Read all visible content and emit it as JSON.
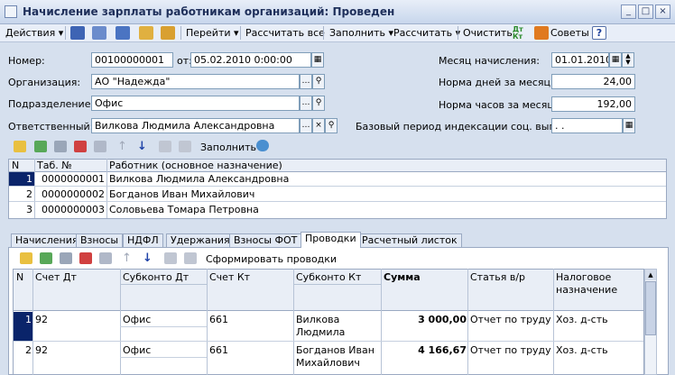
{
  "window": {
    "title": "Начисление зарплаты работникам организаций: Проведен",
    "controls": [
      "_",
      "□",
      "×"
    ]
  },
  "toolbar": {
    "actions": "Действия",
    "goto": "Перейти",
    "recalc_all": "Рассчитать все",
    "fill": "Заполнить",
    "calc": "Рассчитать",
    "clear": "Очистить",
    "tips": "Советы",
    "help": "?"
  },
  "form": {
    "number_label": "Номер:",
    "number_value": "00100000001",
    "date_label": "от:",
    "date_value": "05.02.2010  0:00:00",
    "org_label": "Организация:",
    "org_value": "АО \"Надежда\"",
    "dept_label": "Подразделение:",
    "dept_value": "Офис",
    "resp_label": "Ответственный:",
    "resp_value": "Вилкова Людмила Александровна",
    "month_label": "Месяц начисления:",
    "month_value": "01.01.2010",
    "days_label": "Норма дней за месяц:",
    "days_value": "24,00",
    "hours_label": "Норма часов за месяц:",
    "hours_value": "192,00",
    "base_label": "Базовый период индексации соц. выплат:",
    "base_value": ". .",
    "fill_label": "Заполнить"
  },
  "workers": {
    "headers": [
      "N",
      "Таб. №",
      "Работник (основное назначение)"
    ],
    "rows": [
      {
        "n": "1",
        "tab": "0000000001",
        "name": "Вилкова Людмила Александровна"
      },
      {
        "n": "2",
        "tab": "0000000002",
        "name": "Богданов Иван Михайлович"
      },
      {
        "n": "3",
        "tab": "0000000003",
        "name": "Соловьева Томара Петровна"
      }
    ]
  },
  "tabs": [
    "Начисления",
    "Взносы",
    "НДФЛ",
    "Удержания",
    "Взносы ФОТ",
    "Проводки",
    "Расчетный листок"
  ],
  "postings": {
    "generate_label": "Сформировать проводки",
    "headers": {
      "n": "N",
      "debit": "Счет Дт",
      "sub_debit": "Субконто Дт",
      "credit": "Счет Кт",
      "sub_credit": "Субконто Кт",
      "sum": "Сумма",
      "article": "Статья в/р",
      "tax": "Налоговое назначение"
    },
    "rows": [
      {
        "n": "1",
        "debit": "92",
        "sub_debit": "Офис",
        "credit": "661",
        "sub_credit_1": "Вилкова",
        "sub_credit_2": "Людмила",
        "sum": "3 000,00",
        "article": "Отчет по труду",
        "tax": "Хоз. д-сть"
      },
      {
        "n": "2",
        "debit": "92",
        "sub_debit": "Офис",
        "credit": "661",
        "sub_credit_1": "Богданов Иван",
        "sub_credit_2": "Михайлович",
        "sum": "4 166,67",
        "article": "Отчет по труду",
        "tax": "Хоз. д-сть"
      }
    ]
  }
}
